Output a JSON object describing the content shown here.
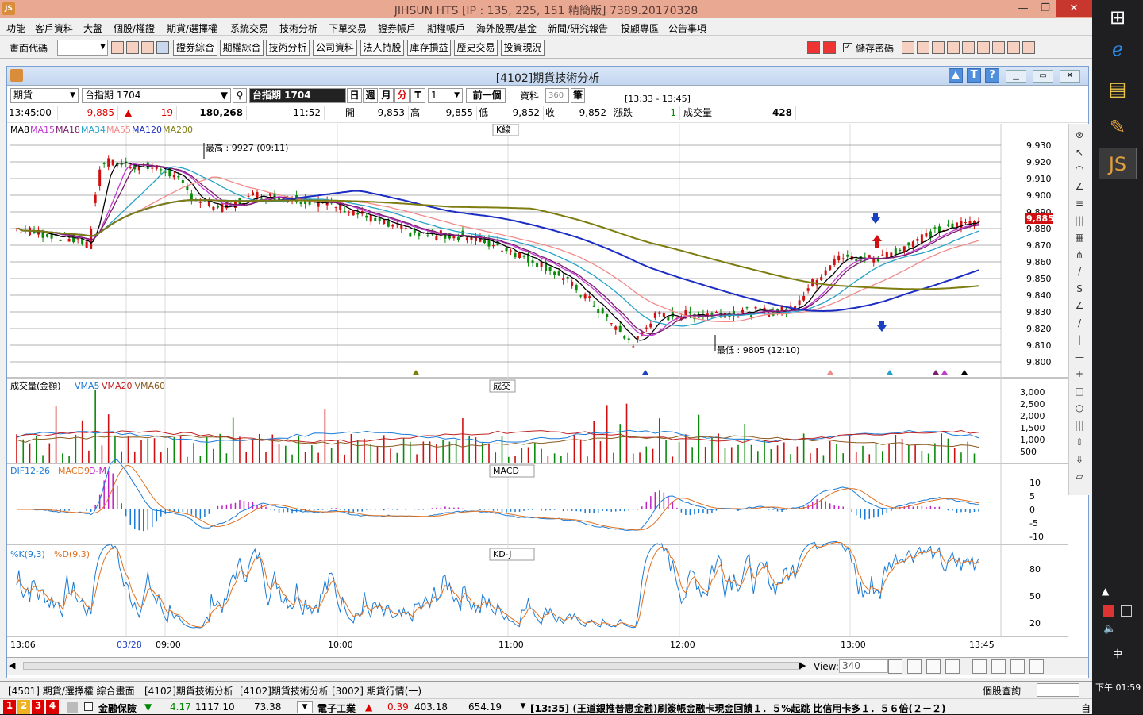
{
  "window": {
    "title": "JIHSUN HTS  [IP : 135, 225, 151 精簡版] 7389.20170328"
  },
  "menu": [
    "功能",
    "客戶資料",
    "大盤",
    "個股/權證",
    "期貨/選擇權",
    "系統交易",
    "技術分析",
    "下單交易",
    "證券帳戶",
    "期權帳戶",
    "海外股票/基金",
    "新聞/研究報告",
    "投顧專區",
    "公告事項"
  ],
  "toolbar": {
    "code_label": "畫面代碼",
    "buttons": [
      "證券綜合",
      "期權綜合",
      "技術分析",
      "公司資料",
      "法人持股",
      "庫存損益",
      "歷史交易",
      "投資現況"
    ],
    "save_pwd": "儲存密碼"
  },
  "inner": {
    "title": "[4102]期貨技術分析",
    "type": "期貨",
    "symbol": "台指期 1704",
    "symbol_dark": "台指期 1704",
    "periods": [
      "日",
      "週",
      "月",
      "分",
      "T"
    ],
    "period_n": "1",
    "prev": "前一個",
    "data_label": "資料",
    "data_count": "360",
    "unit": "筆",
    "range": "[13:33 - 13:45]"
  },
  "info": {
    "time": "13:45:00",
    "price": "9,885",
    "change": "19",
    "volume": "180,268",
    "tick_time": "11:52",
    "open_l": "開",
    "open": "9,853",
    "high_l": "高",
    "high": "9,855",
    "low_l": "低",
    "low": "9,852",
    "close_l": "收",
    "close": "9,852",
    "chg_l": "漲跌",
    "chg": "-1",
    "vol_l": "成交量",
    "vol": "428"
  },
  "panels": {
    "k": {
      "name": "K線",
      "legend": [
        "MA8",
        "MA15",
        "MA18",
        "MA34",
        "MA55",
        "MA120",
        "MA200"
      ],
      "legend_colors": [
        "#000000",
        "#c23ad1",
        "#7a1c6c",
        "#26a2c8",
        "#f28a8a",
        "#1c2dc4",
        "#7d7d10"
      ],
      "high_note": "最高 : 9927 (09:11)",
      "low_note": "最低 : 9805 (12:10)",
      "last": "9,885",
      "ticks": [
        "9,930",
        "9,920",
        "9,910",
        "9,900",
        "9,890",
        "9,880",
        "9,870",
        "9,860",
        "9,850",
        "9,840",
        "9,830",
        "9,820",
        "9,810",
        "9,800"
      ]
    },
    "vol": {
      "name": "成交",
      "legend": [
        "成交量(金額)",
        "VMA5",
        "VMA20",
        "VMA60"
      ],
      "legend_colors": [
        "#000000",
        "#1a7bd6",
        "#c02020",
        "#8a5a20"
      ],
      "ticks": [
        "3,000",
        "2,500",
        "2,000",
        "1,500",
        "1,000",
        "500"
      ]
    },
    "macd": {
      "name": "MACD",
      "legend": [
        "DIF12-26",
        "MACD9",
        "D-M"
      ],
      "legend_colors": [
        "#1a7bd6",
        "#e07020",
        "#c020c0"
      ],
      "ticks": [
        "10",
        "5",
        "0",
        "-5",
        "-10"
      ]
    },
    "kd": {
      "name": "KD-J",
      "legend": [
        "%K(9,3)",
        "%D(9,3)"
      ],
      "legend_colors": [
        "#1a7bd6",
        "#e07020"
      ],
      "ticks": [
        "80",
        "50",
        "20"
      ]
    }
  },
  "xaxis": [
    "13:06",
    "03/28",
    "09:00",
    "10:00",
    "11:00",
    "12:00",
    "13:00",
    "13:45"
  ],
  "view": {
    "label": "View:",
    "value": "340"
  },
  "tabs": [
    "[4501] 期貨/選擇權 綜合畫面",
    "[4102]期貨技術分析",
    "[4102]期貨技術分析",
    "[3002] 期貨行情(一)",
    "個股查詢"
  ],
  "ticker": {
    "nums": [
      "1",
      "2",
      "3",
      "4"
    ],
    "item1": "金融保險",
    "d1": "4.17",
    "v1": "1117.10",
    "p1": "73.38",
    "item2": "電子工業",
    "d2": "0.39",
    "v2": "403.18",
    "p2": "654.19",
    "news": "[13:35] (王道銀推普惠金融)刷簽帳金融卡現金回饋１．５%起跳 比信用卡多１．５６倍(２－２)",
    "right": "自"
  },
  "clock": "下午 01:59"
}
